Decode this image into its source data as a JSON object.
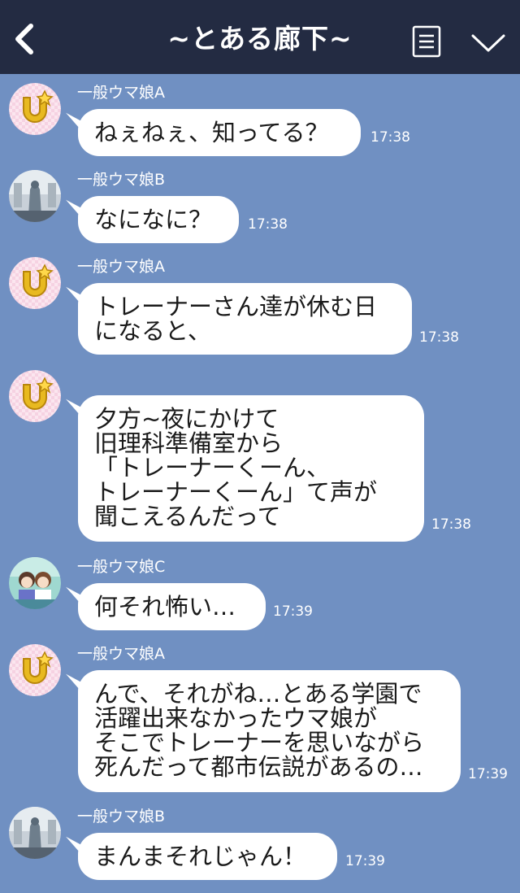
{
  "header": {
    "title": "~とある廊下~",
    "back_icon": "chevron-left-icon",
    "menu_icon": "list-icon",
    "collapse_icon": "chevron-down-icon"
  },
  "colors": {
    "header_bg": "#232b42",
    "chat_bg": "#7090c2",
    "bubble_bg": "#ffffff"
  },
  "messages": [
    {
      "sender": "一般ウマ娘A",
      "avatar": "horseshoe-avatar",
      "text": "ねぇねぇ、知ってる？",
      "time": "17:38"
    },
    {
      "sender": "一般ウマ娘B",
      "avatar": "statue-avatar",
      "text": "なになに？",
      "time": "17:38"
    },
    {
      "sender": "一般ウマ娘A",
      "avatar": "horseshoe-avatar",
      "text": "トレーナーさん達が休む日\nになると、",
      "time": "17:38"
    },
    {
      "sender": "",
      "avatar": "horseshoe-avatar",
      "text": "夕方~夜にかけて\n旧理科準備室から\n「トレーナーくーん、\n トレーナーくーん」て声が\n聞こえるんだって",
      "time": "17:38"
    },
    {
      "sender": "一般ウマ娘C",
      "avatar": "girls-avatar",
      "text": "何それ怖い…",
      "time": "17:39"
    },
    {
      "sender": "一般ウマ娘A",
      "avatar": "horseshoe-avatar",
      "text": "んで、それがね…とある学園で\n活躍出来なかったウマ娘が\nそこでトレーナーを思いながら\n死んだって都市伝説があるの…",
      "time": "17:39"
    },
    {
      "sender": "一般ウマ娘B",
      "avatar": "statue-avatar",
      "text": "まんまそれじゃん！",
      "time": "17:39"
    }
  ]
}
